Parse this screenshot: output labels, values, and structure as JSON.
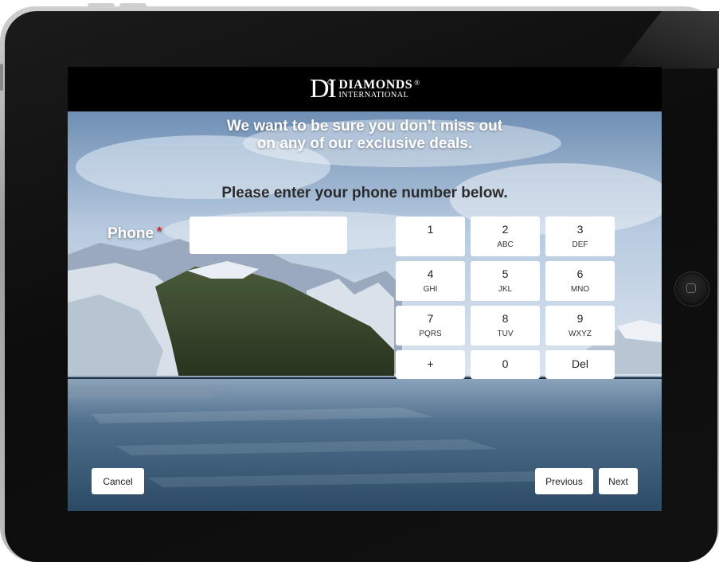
{
  "brand": {
    "logo_initials": "DI",
    "logo_line1": "DIAMONDS",
    "logo_line2": "INTERNATIONAL",
    "logo_mark": "®"
  },
  "headline": {
    "line1": "We want to be sure you don't miss out",
    "line2": "on any of our exclusive deals."
  },
  "instruction": "Please enter your phone number below.",
  "phone_field": {
    "label": "Phone",
    "required_marker": "*",
    "value": "",
    "placeholder": ""
  },
  "keypad": {
    "keys": [
      {
        "digit": "1",
        "letters": ""
      },
      {
        "digit": "2",
        "letters": "ABC"
      },
      {
        "digit": "3",
        "letters": "DEF"
      },
      {
        "digit": "4",
        "letters": "GHI"
      },
      {
        "digit": "5",
        "letters": "JKL"
      },
      {
        "digit": "6",
        "letters": "MNO"
      },
      {
        "digit": "7",
        "letters": "PQRS"
      },
      {
        "digit": "8",
        "letters": "TUV"
      },
      {
        "digit": "9",
        "letters": "WXYZ"
      },
      {
        "digit": "+",
        "letters": ""
      },
      {
        "digit": "0",
        "letters": ""
      },
      {
        "digit": "Del",
        "letters": ""
      }
    ]
  },
  "navigation": {
    "cancel_label": "Cancel",
    "previous_label": "Previous",
    "next_label": "Next"
  },
  "colors": {
    "required": "#d0232a",
    "header_bg": "#000000",
    "button_bg": "#ffffff"
  }
}
